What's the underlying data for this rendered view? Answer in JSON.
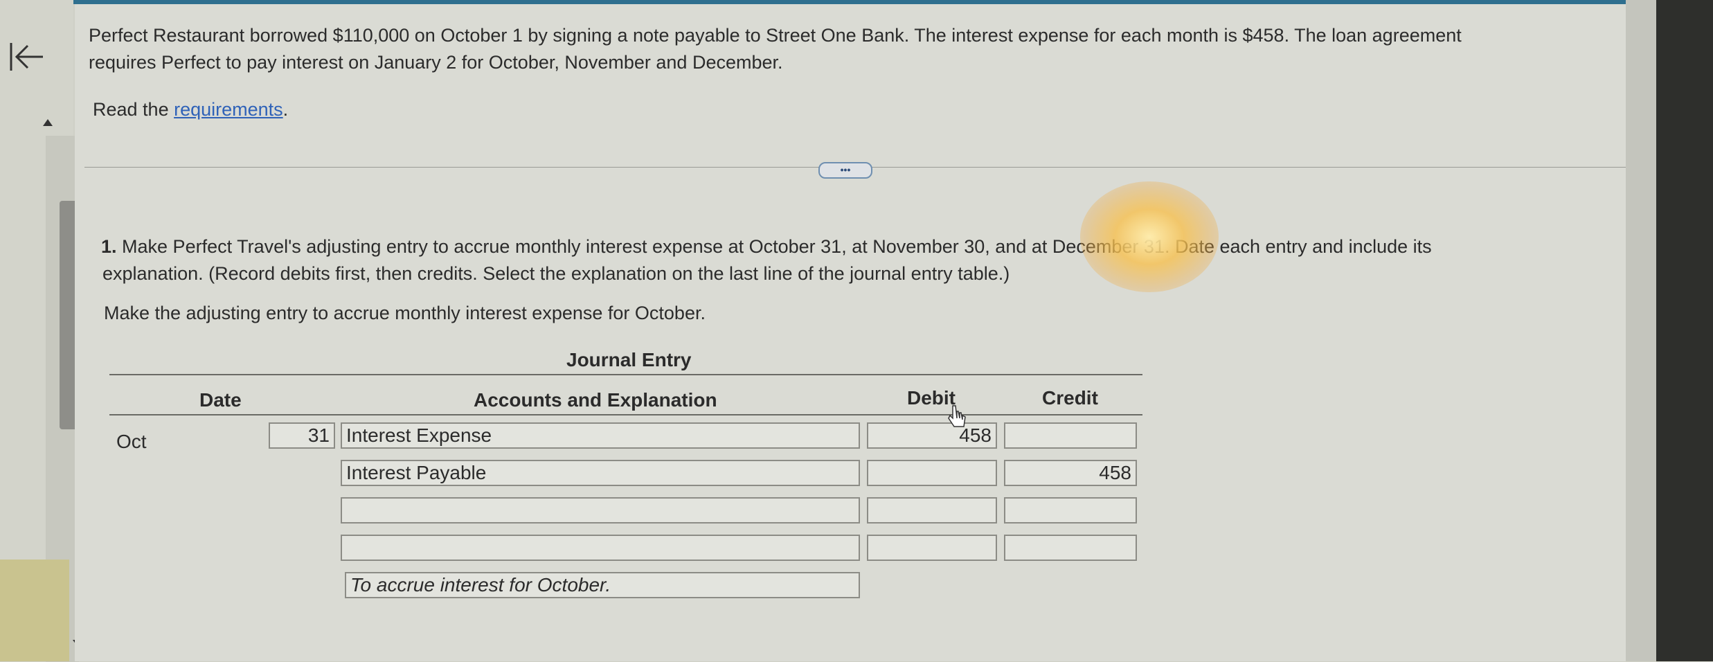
{
  "problem": {
    "line1": "Perfect Restaurant borrowed $110,000 on October 1 by signing a note payable to Street One Bank. The interest expense for each month is $458. The loan agreement",
    "line2": "requires Perfect to pay interest on January 2 for October, November and December.",
    "read_prefix": "Read the ",
    "read_link": "requirements",
    "read_suffix": "."
  },
  "more_button": "•••",
  "question": {
    "number": "1.",
    "line1": " Make Perfect Travel's adjusting entry to accrue monthly interest expense at October 31, at November 30, and at December 31. Date each entry and include its",
    "line2": "explanation. (Record debits first, then credits. Select the explanation on the last line of the journal entry table.)",
    "instruction": "Make the adjusting entry to accrue monthly interest expense for October."
  },
  "journal": {
    "title": "Journal Entry",
    "headers": {
      "date": "Date",
      "accounts": "Accounts and Explanation",
      "debit": "Debit",
      "credit": "Credit"
    },
    "month": "Oct",
    "day": "31",
    "rows": [
      {
        "account": "Interest Expense",
        "debit": "458",
        "credit": ""
      },
      {
        "account": "Interest Payable",
        "debit": "",
        "credit": "458"
      },
      {
        "account": "",
        "debit": "",
        "credit": ""
      },
      {
        "account": "",
        "debit": "",
        "credit": ""
      }
    ],
    "explanation": "To accrue interest for October."
  }
}
